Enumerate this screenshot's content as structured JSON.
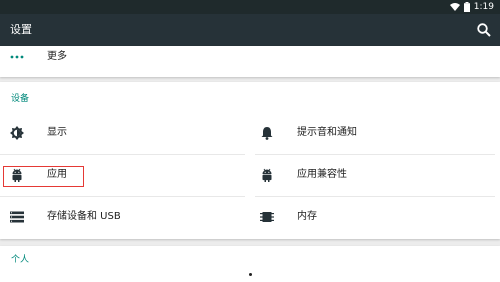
{
  "status_bar": {
    "time": "1:19"
  },
  "app_bar": {
    "title": "设置"
  },
  "top_card": {
    "more_label": "更多"
  },
  "device_section": {
    "title": "设备",
    "items": [
      {
        "label": "显示",
        "icon": "brightness-icon"
      },
      {
        "label": "提示音和通知",
        "icon": "bell-icon"
      },
      {
        "label": "应用",
        "icon": "android-icon"
      },
      {
        "label": "应用兼容性",
        "icon": "android-icon"
      },
      {
        "label": "存储设备和 USB",
        "icon": "storage-icon"
      },
      {
        "label": "内存",
        "icon": "memory-icon"
      }
    ]
  },
  "personal_section": {
    "title": "个人"
  },
  "colors": {
    "accent": "#00897b",
    "appbar": "#263238",
    "highlight": "#e53935"
  }
}
